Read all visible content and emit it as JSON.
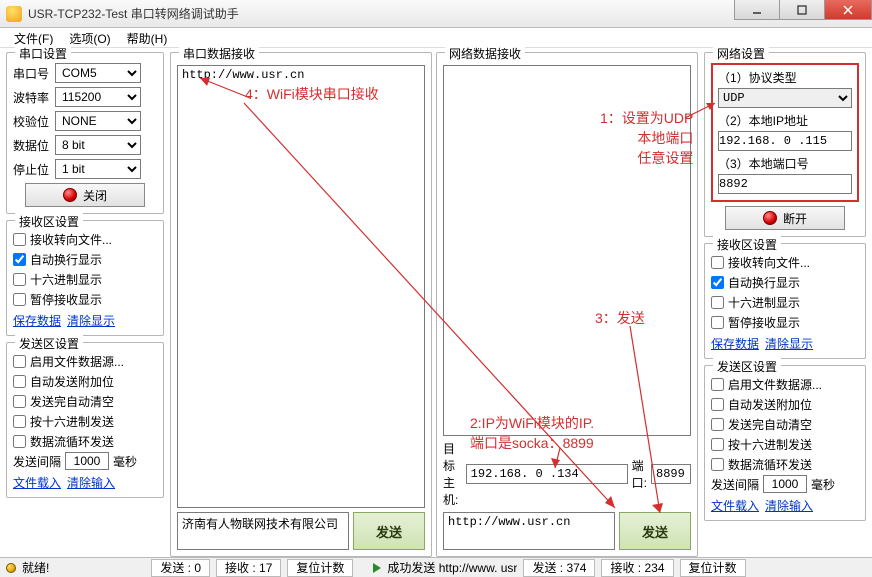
{
  "window": {
    "title": "USR-TCP232-Test 串口转网络调试助手"
  },
  "menu": {
    "file": "文件(F)",
    "options": "选项(O)",
    "help": "帮助(H)"
  },
  "serial": {
    "group": "串口设置",
    "port_label": "串口号",
    "port": "COM5",
    "baud_label": "波特率",
    "baud": "115200",
    "parity_label": "校验位",
    "parity": "NONE",
    "data_label": "数据位",
    "data": "8 bit",
    "stop_label": "停止位",
    "stop": "1 bit",
    "close_btn": "关闭"
  },
  "rx_settings": {
    "group": "接收区设置",
    "to_file": "接收转向文件...",
    "auto_wrap": "自动换行显示",
    "hex": "十六进制显示",
    "pause": "暂停接收显示",
    "save": "保存数据",
    "clear": "清除显示"
  },
  "tx_settings": {
    "group": "发送区设置",
    "from_file": "启用文件数据源...",
    "auto_suffix": "自动发送附加位",
    "auto_clear": "发送完自动清空",
    "hex_send": "按十六进制发送",
    "loop_send": "数据流循环发送",
    "interval_label": "发送间隔",
    "interval_val": "1000",
    "interval_unit": "毫秒",
    "file_load": "文件载入",
    "clear_input": "清除输入"
  },
  "serial_rx": {
    "group": "串口数据接收",
    "content": "http://www.usr.cn"
  },
  "net_rx": {
    "group": "网络数据接收",
    "content": ""
  },
  "target": {
    "host_label": "目标主机:",
    "host": "192.168. 0 .134",
    "port_label": "端口:",
    "port": "8899"
  },
  "serial_tx": {
    "text": "济南有人物联网技术有限公司",
    "send": "发送"
  },
  "net_tx": {
    "text": "http://www.usr.cn",
    "send": "发送"
  },
  "net_settings": {
    "group": "网络设置",
    "proto_label": "（1）协议类型",
    "proto": "UDP",
    "ip_label": "（2）本地IP地址",
    "ip": "192.168. 0 .115",
    "port_label": "（3）本地端口号",
    "port": "8892",
    "disconnect_btn": "断开"
  },
  "status": {
    "ready": "就绪!",
    "serial_send": "发送 : 0",
    "serial_recv": "接收 : 17",
    "reset1": "复位计数",
    "net_ok": "成功发送 http://www. usr",
    "net_send": "发送 : 374",
    "net_recv": "接收 : 234",
    "reset2": "复位计数"
  },
  "annotations": {
    "a1": "1：设置为UDP\n本地端口\n任意设置",
    "a2": "2:IP为WiFi模块的IP.\n端口是socka：8899",
    "a3": "3：发送",
    "a4": "4：WiFi模块串口接收"
  }
}
